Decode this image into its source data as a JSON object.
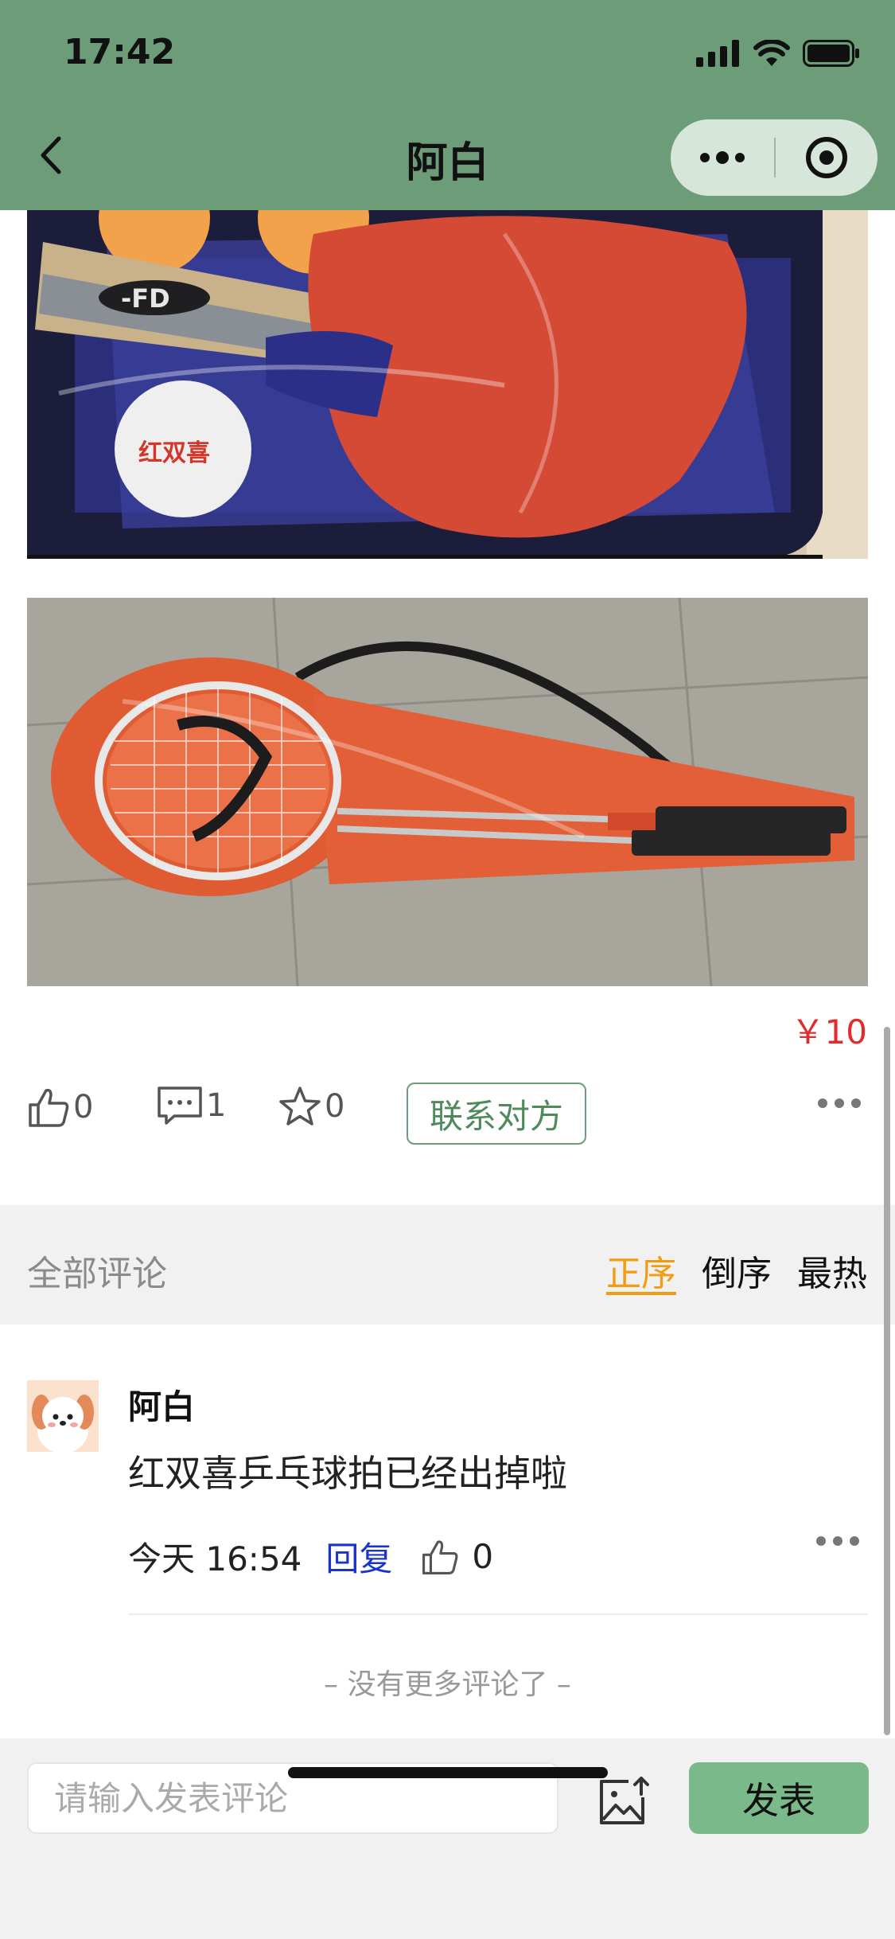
{
  "status": {
    "time": "17:42"
  },
  "nav": {
    "title": "阿白"
  },
  "post": {
    "price": "￥10"
  },
  "actions": {
    "likes": "0",
    "comments": "1",
    "favorites": "0",
    "contact_label": "联系对方"
  },
  "comments_header": {
    "label": "全部评论",
    "sort_options": [
      "正序",
      "倒序",
      "最热"
    ],
    "active_sort": "正序"
  },
  "comments": [
    {
      "author": "阿白",
      "text": "红双喜乒乓球拍已经出掉啦",
      "time": "今天 16:54",
      "reply_label": "回复",
      "likes": "0"
    }
  ],
  "no_more_text": "– 没有更多评论了 –",
  "bottom_bar": {
    "input_placeholder": "请输入发表评论",
    "send_label": "发表"
  },
  "colors": {
    "header_bg": "#6d9d78",
    "price": "#e02c2c",
    "active_sort": "#f39c12",
    "reply_link": "#1a33cc",
    "send_btn": "#7ab98a"
  }
}
